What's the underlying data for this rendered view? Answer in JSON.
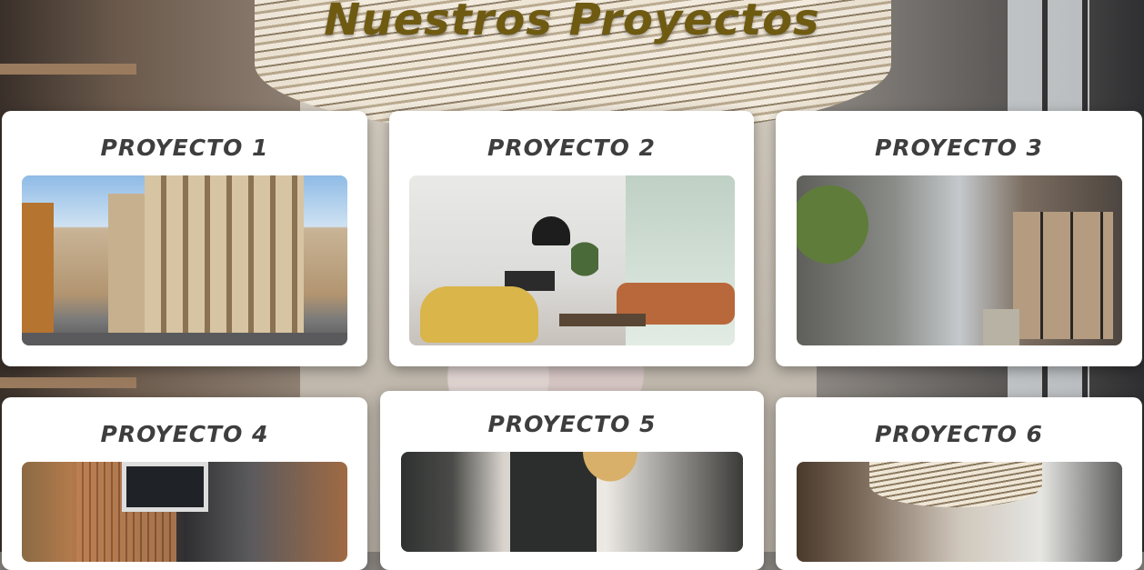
{
  "page": {
    "title": "Nuestros Proyectos"
  },
  "projects": [
    {
      "title": "PROYECTO 1",
      "image_alt": "historic-street-building"
    },
    {
      "title": "PROYECTO 2",
      "image_alt": "modern-living-room"
    },
    {
      "title": "PROYECTO 3",
      "image_alt": "modern-apartment-courtyard"
    },
    {
      "title": "PROYECTO 4",
      "image_alt": "wood-facade-building"
    },
    {
      "title": "PROYECTO 5",
      "image_alt": "interior-with-pendant-lamps"
    },
    {
      "title": "PROYECTO 6",
      "image_alt": "corridor-with-wave-ceiling"
    }
  ],
  "colors": {
    "title": "#6f5a12",
    "card_title": "#3e3e3e",
    "card_bg": "#ffffff"
  }
}
